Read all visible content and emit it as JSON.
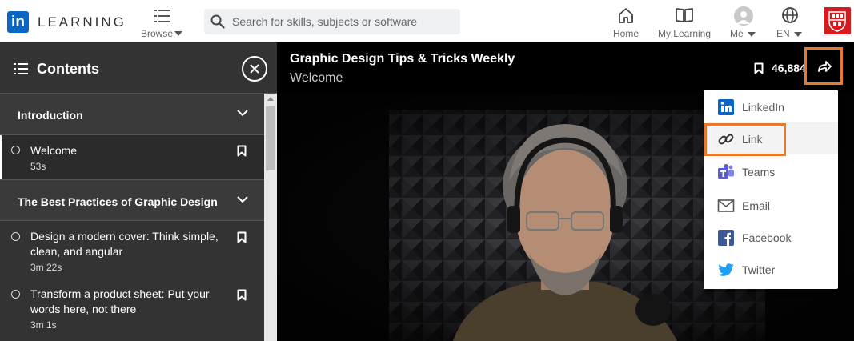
{
  "brand": {
    "logo_text": "in",
    "wordmark": "LEARNING",
    "linkedin_blue": "#0a66c2"
  },
  "nav": {
    "browse_label": "Browse",
    "search_placeholder": "Search for skills, subjects or software",
    "home_label": "Home",
    "my_learning_label": "My Learning",
    "me_label": "Me",
    "language_label": "EN"
  },
  "sidebar": {
    "title": "Contents",
    "sections": [
      {
        "title": "Introduction",
        "items": [
          {
            "title": "Welcome",
            "duration": "53s",
            "active": true
          }
        ]
      },
      {
        "title": "The Best Practices of Graphic Design",
        "items": [
          {
            "title": "Design a modern cover: Think simple, clean, and angular",
            "duration": "3m 22s"
          },
          {
            "title": "Transform a product sheet: Put your words here, not there",
            "duration": "3m 1s"
          }
        ]
      }
    ]
  },
  "player": {
    "course_title": "Graphic Design Tips & Tricks Weekly",
    "video_title": "Welcome",
    "save_count": "46,884"
  },
  "share_menu": {
    "items": [
      {
        "label": "LinkedIn",
        "icon": "linkedin-icon"
      },
      {
        "label": "Link",
        "icon": "link-icon"
      },
      {
        "label": "Teams",
        "icon": "teams-icon"
      },
      {
        "label": "Email",
        "icon": "email-icon"
      },
      {
        "label": "Facebook",
        "icon": "facebook-icon"
      },
      {
        "label": "Twitter",
        "icon": "twitter-icon"
      }
    ]
  },
  "colors": {
    "highlight": "#e8782c",
    "sidebar_bg": "#333333",
    "teams_purple": "#5b5fc7",
    "facebook_blue": "#3b5998",
    "twitter_blue": "#1da1f2",
    "school_red": "#d71920"
  }
}
